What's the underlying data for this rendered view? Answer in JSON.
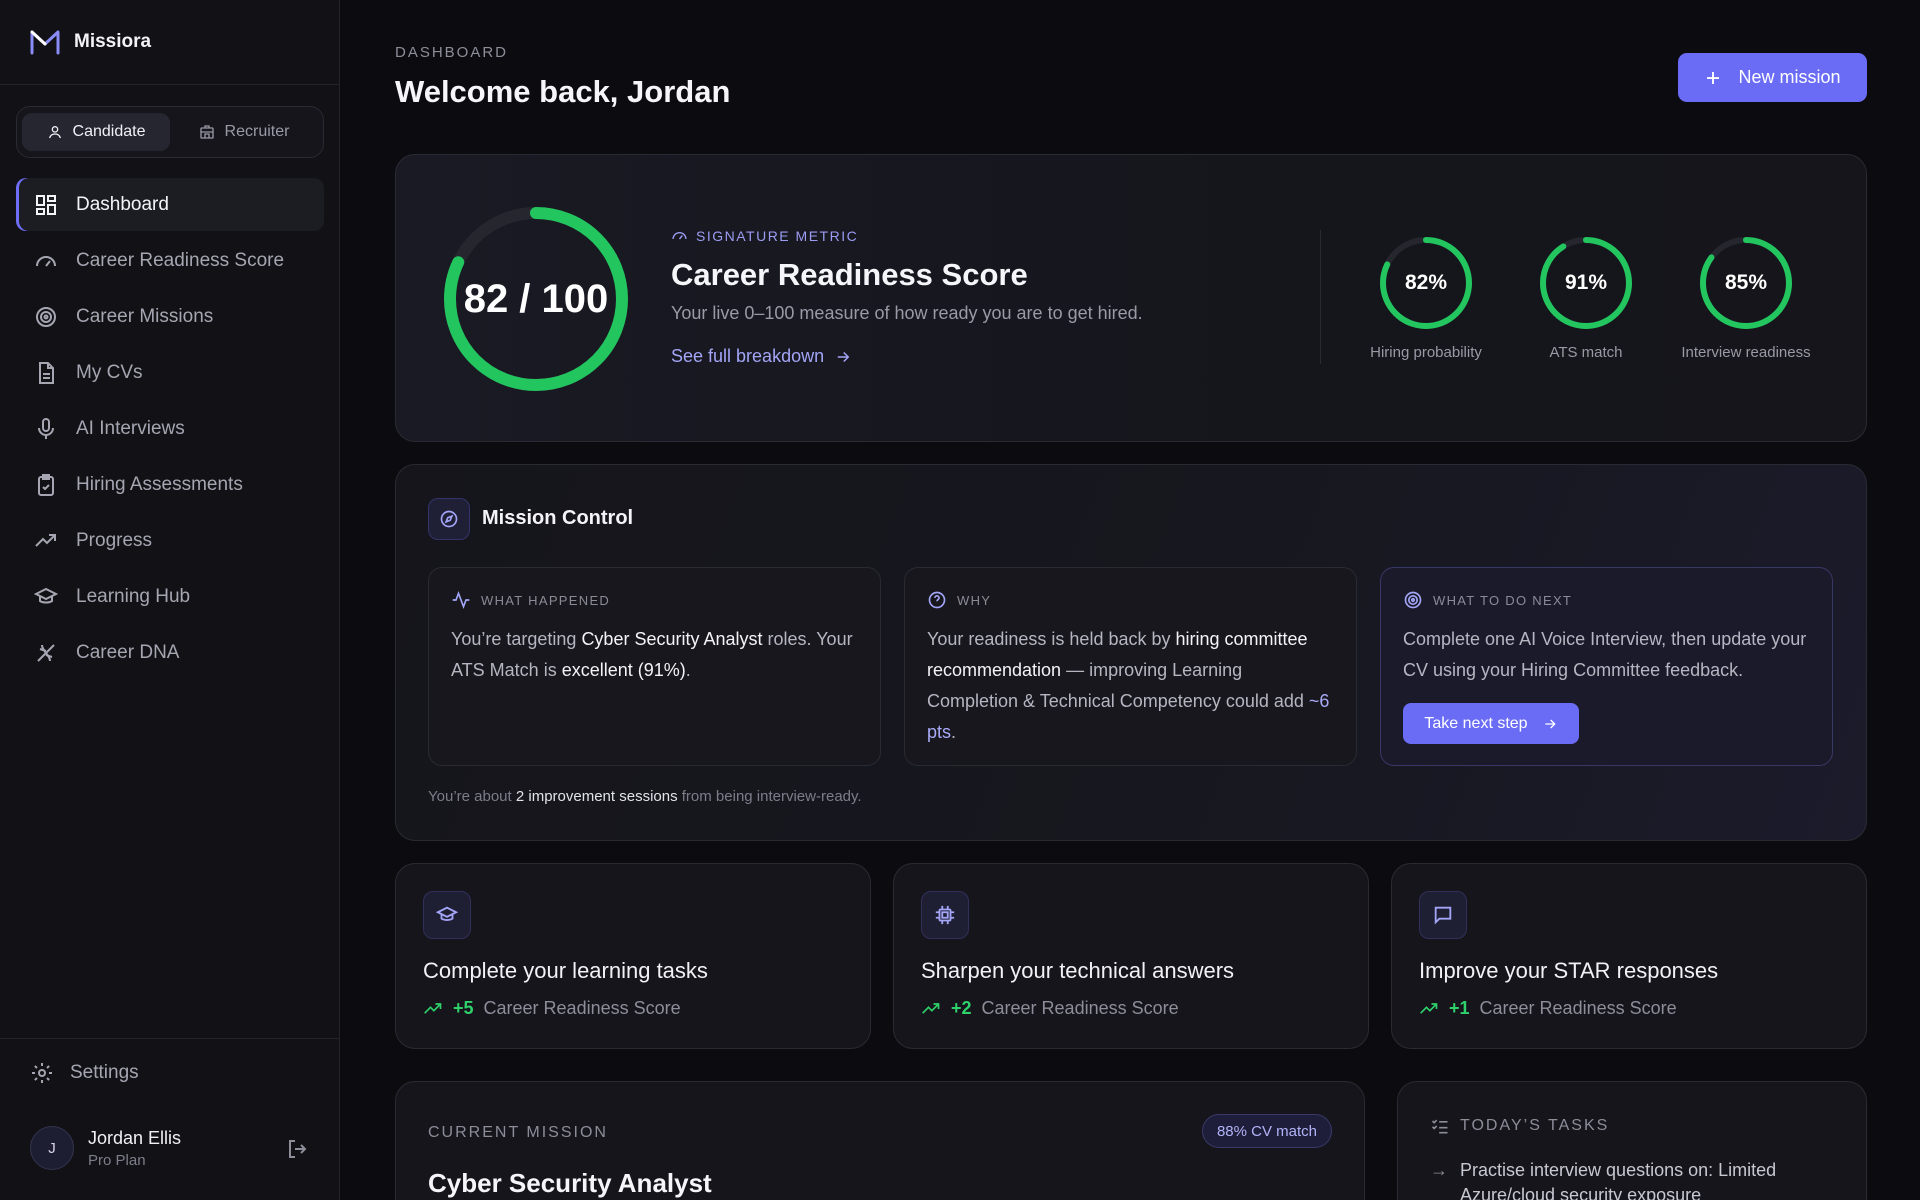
{
  "brand": {
    "name": "Missiora"
  },
  "role_toggle": {
    "candidate": "Candidate",
    "recruiter": "Recruiter"
  },
  "nav": [
    {
      "label": "Dashboard",
      "icon": "grid-icon"
    },
    {
      "label": "Career Readiness Score",
      "icon": "gauge-icon"
    },
    {
      "label": "Career Missions",
      "icon": "target-icon"
    },
    {
      "label": "My CVs",
      "icon": "document-icon"
    },
    {
      "label": "AI Interviews",
      "icon": "microphone-icon"
    },
    {
      "label": "Hiring Assessments",
      "icon": "clipboard-check-icon"
    },
    {
      "label": "Progress",
      "icon": "trending-up-icon"
    },
    {
      "label": "Learning Hub",
      "icon": "graduation-cap-icon"
    },
    {
      "label": "Career DNA",
      "icon": "dna-icon"
    }
  ],
  "settings_label": "Settings",
  "user": {
    "initial": "J",
    "name": "Jordan Ellis",
    "plan": "Pro Plan"
  },
  "header": {
    "eyebrow": "DASHBOARD",
    "welcome": "Welcome back, Jordan",
    "new_mission": "New mission"
  },
  "score": {
    "value": 82,
    "max": 100,
    "display": "82 / 100",
    "label": "SIGNATURE METRIC",
    "title": "Career Readiness Score",
    "subtitle": "Your live 0–100 measure of how ready you are to get hired.",
    "link": "See full breakdown",
    "metrics": [
      {
        "value": 82,
        "display": "82%",
        "label": "Hiring probability"
      },
      {
        "value": 91,
        "display": "91%",
        "label": "ATS match"
      },
      {
        "value": 85,
        "display": "85%",
        "label": "Interview readiness"
      }
    ]
  },
  "mission_control": {
    "title": "Mission Control",
    "what_happened": {
      "head": "WHAT HAPPENED",
      "t1": "You’re targeting ",
      "b1": "Cyber Security Analyst",
      "t2": " roles. Your ATS Match is ",
      "b2": "excellent (91%)",
      "t3": "."
    },
    "why": {
      "head": "WHY",
      "t1": "Your readiness is held back by ",
      "b1": "hiring committee recommendation",
      "t2": " — improving Learning Completion & Technical Competency could add ",
      "hl": "~6 pts",
      "t3": "."
    },
    "next": {
      "head": "WHAT TO DO NEXT",
      "text": "Complete one AI Voice Interview, then update your CV using your Hiring Committee feedback.",
      "button": "Take next step"
    },
    "footer": {
      "t1": "You’re about ",
      "b1": "2 improvement sessions",
      "t2": " from being interview-ready."
    }
  },
  "actions": [
    {
      "title": "Complete your learning tasks",
      "gain": "+5",
      "metric": "Career Readiness Score",
      "icon": "graduation-cap-icon"
    },
    {
      "title": "Sharpen your technical answers",
      "gain": "+2",
      "metric": "Career Readiness Score",
      "icon": "cpu-chip-icon"
    },
    {
      "title": "Improve your STAR responses",
      "gain": "+1",
      "metric": "Career Readiness Score",
      "icon": "chat-bubble-icon"
    }
  ],
  "current_mission": {
    "label": "CURRENT MISSION",
    "badge": "88% CV match",
    "title": "Cyber Security Analyst"
  },
  "todays_tasks": {
    "label": "TODAY’S TASKS",
    "item1": "Practise interview questions on: Limited Azure/cloud security exposure"
  },
  "colors": {
    "accent": "#6b6cf5",
    "ring": "#22c55e",
    "gain": "#2fd16b"
  }
}
